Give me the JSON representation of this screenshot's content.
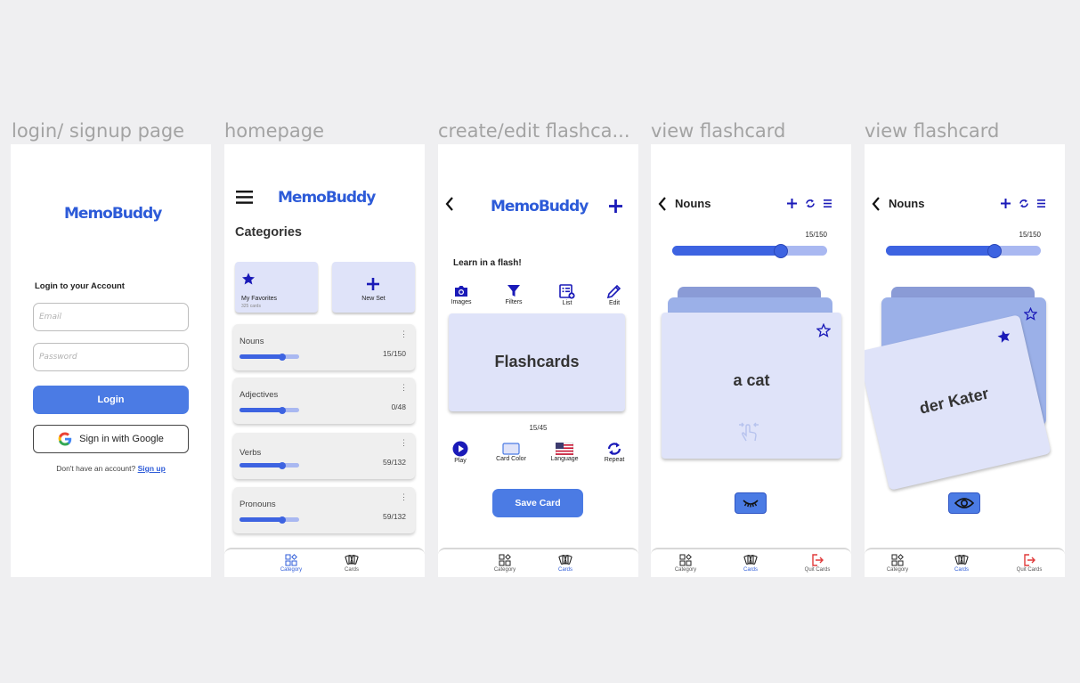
{
  "frames": {
    "login": "login/ signup page",
    "home": "homepage",
    "editor": "create/edit flashca...",
    "view1": "view flashcard",
    "view2": "view flashcard"
  },
  "app": {
    "logo": "MemoBuddy"
  },
  "login": {
    "heading": "Login to your Account",
    "email_placeholder": "Email",
    "password_placeholder": "Password",
    "login_button": "Login",
    "google_button": "Sign in with Google",
    "no_account_text": "Don't have an account?",
    "signup_link": "Sign up"
  },
  "home": {
    "section_title": "Categories",
    "favorites_label": "My Favorites",
    "favorites_count": "325 cards",
    "new_set_label": "New Set",
    "categories": [
      {
        "name": "Nouns",
        "count": "15/150",
        "progress": 0.72
      },
      {
        "name": "Adjectives",
        "count": "0/48",
        "progress": 0.72
      },
      {
        "name": "Verbs",
        "count": "59/132",
        "progress": 0.72
      },
      {
        "name": "Pronouns",
        "count": "59/132",
        "progress": 0.72
      }
    ]
  },
  "nav": {
    "category": "Category",
    "cards": "Cards",
    "quit": "Quit Cards"
  },
  "editor": {
    "tagline": "Learn in a flash!",
    "tools": [
      "Images",
      "Filters",
      "List",
      "Edit"
    ],
    "card_text": "Flashcards",
    "card_count": "15/45",
    "actions": [
      "Play",
      "Card Color",
      "Language",
      "Repeat"
    ],
    "save_button": "Save Card"
  },
  "view1": {
    "title": "Nouns",
    "progress_label": "15/150",
    "progress": 0.7,
    "card_text": "a cat",
    "favorite": false
  },
  "view2": {
    "title": "Nouns",
    "progress_label": "15/150",
    "progress": 0.7,
    "card_text": "der Kater",
    "favorite": true
  },
  "colors": {
    "brand": "#2d5bd8",
    "accent": "#4b7be4",
    "card": "#dfe3f9",
    "track": "#a9b8f1",
    "icon": "#1a1ab8",
    "quit": "#e03a3a"
  }
}
